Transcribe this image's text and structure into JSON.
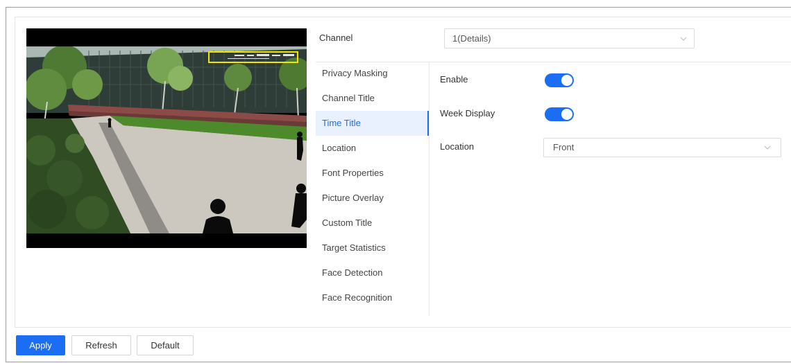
{
  "channel": {
    "label": "Channel",
    "value": "1(Details)"
  },
  "menu": {
    "items": [
      "Privacy Masking",
      "Channel Title",
      "Time Title",
      "Location",
      "Font Properties",
      "Picture Overlay",
      "Custom Title",
      "Target Statistics",
      "Face Detection",
      "Face Recognition"
    ],
    "selected_index": 2
  },
  "settings": {
    "enable": {
      "label": "Enable",
      "on": true
    },
    "week_display": {
      "label": "Week Display",
      "on": true
    },
    "location": {
      "label": "Location",
      "value": "Front"
    }
  },
  "buttons": {
    "apply": "Apply",
    "refresh": "Refresh",
    "default": "Default"
  },
  "icons": {
    "select_chevron": "chevron-down-icon"
  },
  "colors": {
    "accent": "#1b6ef3",
    "selected_bg": "#e8f1fd",
    "overlay_box": "#f2e600"
  }
}
